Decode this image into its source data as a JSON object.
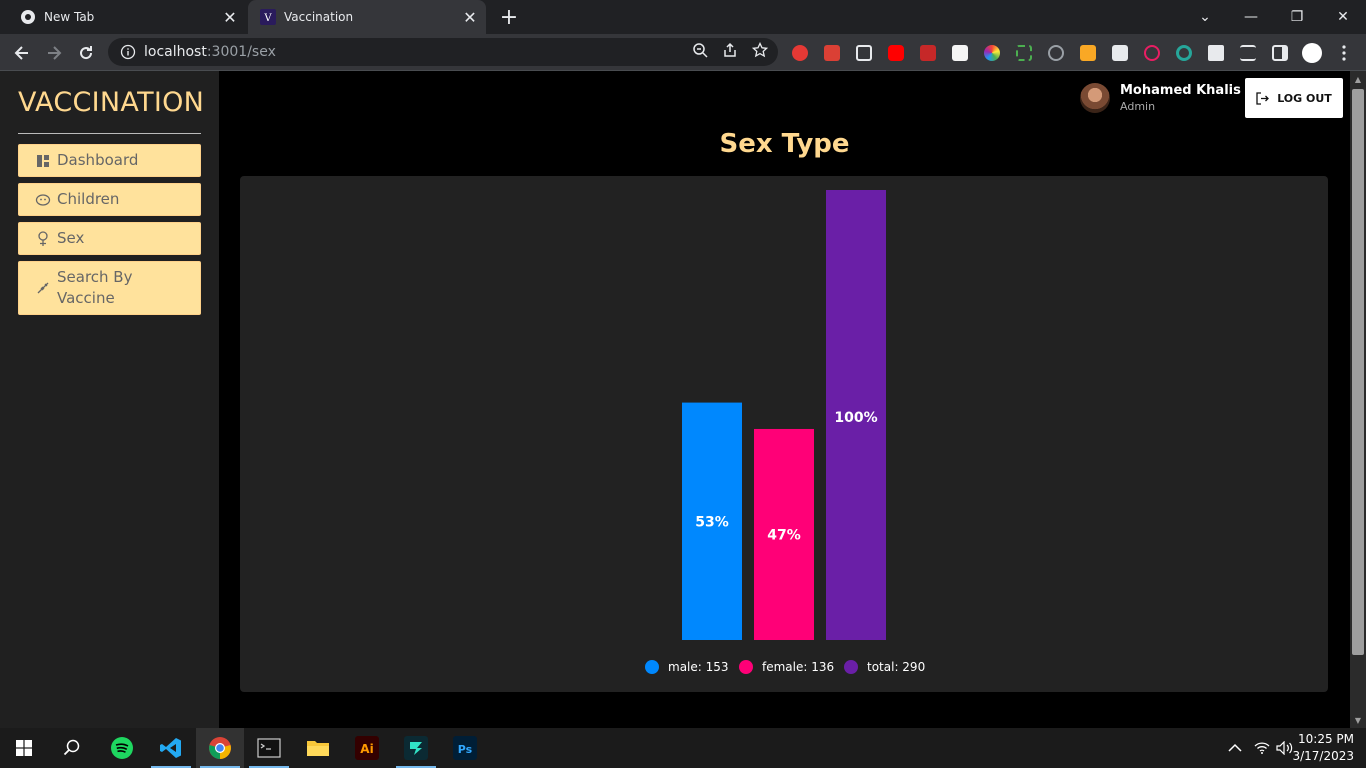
{
  "browser": {
    "tabs": [
      {
        "title": "New Tab",
        "active": false
      },
      {
        "title": "Vaccination",
        "active": true
      }
    ],
    "url_host": "localhost",
    "url_path": ":3001/sex"
  },
  "sidebar": {
    "brand": "VACCINATION",
    "items": [
      {
        "label": "Dashboard",
        "icon": "dashboard-icon"
      },
      {
        "label": "Children",
        "icon": "baby-face-icon"
      },
      {
        "label": "Sex",
        "icon": "female-symbol-icon"
      },
      {
        "label": "Search By Vaccine",
        "icon": "syringe-icon"
      }
    ]
  },
  "header": {
    "user_name": "Mohamed Khalis",
    "user_role": "Admin",
    "logout_label": "LOG OUT"
  },
  "main": {
    "title": "Sex Type"
  },
  "colors": {
    "accent": "#ffd88f",
    "menu_bg": "#ffe29c",
    "male": "#0088fe",
    "female": "#ff0077",
    "total": "#6a1fa7"
  },
  "chart_data": {
    "type": "bar",
    "categories": [
      "male",
      "female",
      "total"
    ],
    "values": [
      153,
      136,
      290
    ],
    "bar_labels": [
      "53%",
      "47%",
      "100%"
    ],
    "legend": [
      "male: 153",
      "female: 136",
      "total: 290"
    ],
    "ylim": [
      0,
      290
    ],
    "grid": false,
    "legend_position": "bottom-center"
  },
  "taskbar": {
    "time": "10:25 PM",
    "date": "3/17/2023"
  }
}
